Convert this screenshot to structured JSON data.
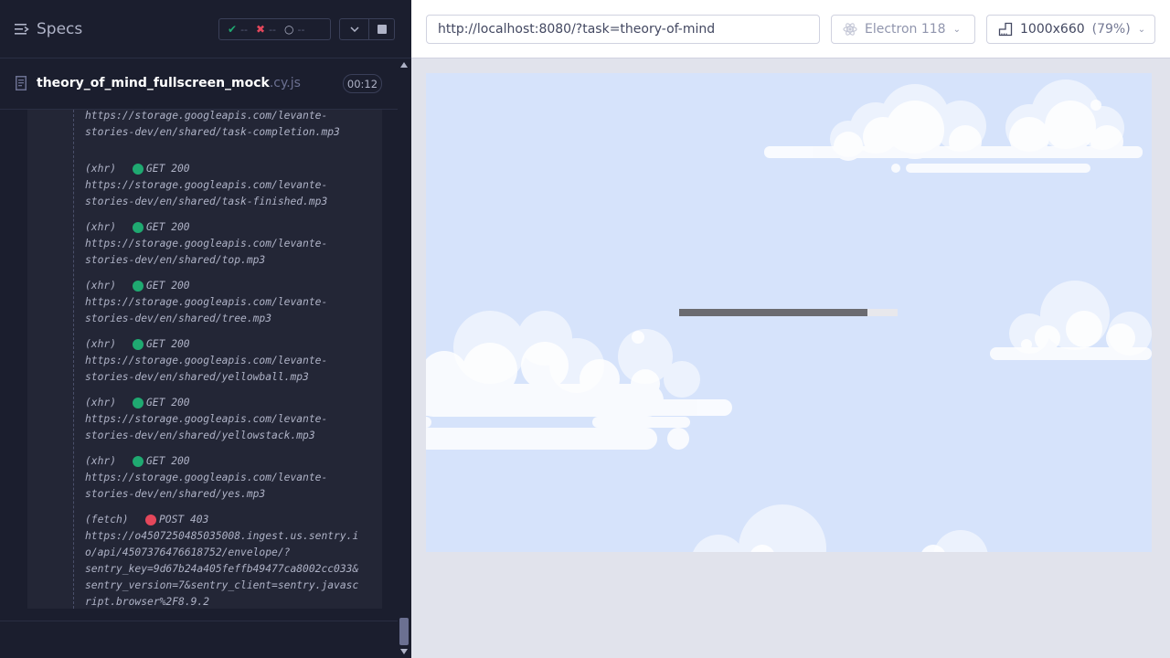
{
  "reporter": {
    "specs_label": "Specs",
    "stats": {
      "passed": "--",
      "failed": "--",
      "pending": "--"
    },
    "spec_file": {
      "name": "theory_of_mind_fullscreen_mock",
      "ext": ".cy.js"
    },
    "duration": "00:12"
  },
  "log": {
    "entries": [
      {
        "kind": "",
        "status": "",
        "method": "",
        "url": "https://storage.googleapis.com/levante-\nstories-dev/en/shared/task-completion.mp3"
      },
      {
        "kind": "(xhr)",
        "status": "ok",
        "method": "GET 200",
        "url": "https://storage.googleapis.com/levante-\nstories-dev/en/shared/task-finished.mp3"
      },
      {
        "kind": "(xhr)",
        "status": "ok",
        "method": "GET 200",
        "url": "https://storage.googleapis.com/levante-\nstories-dev/en/shared/top.mp3"
      },
      {
        "kind": "(xhr)",
        "status": "ok",
        "method": "GET 200",
        "url": "https://storage.googleapis.com/levante-\nstories-dev/en/shared/tree.mp3"
      },
      {
        "kind": "(xhr)",
        "status": "ok",
        "method": "GET 200",
        "url": "https://storage.googleapis.com/levante-\nstories-dev/en/shared/yellowball.mp3"
      },
      {
        "kind": "(xhr)",
        "status": "ok",
        "method": "GET 200",
        "url": "https://storage.googleapis.com/levante-\nstories-dev/en/shared/yellowstack.mp3"
      },
      {
        "kind": "(xhr)",
        "status": "ok",
        "method": "GET 200",
        "url": "https://storage.googleapis.com/levante-\nstories-dev/en/shared/yes.mp3"
      },
      {
        "kind": "(fetch)",
        "status": "err",
        "method": "POST 403",
        "url": "https://o4507250485035008.ingest.us.sentry.i\no/api/4507376476618752/envelope/?\nsentry_key=9d67b24a405feffb49477ca8002cc033&\nsentry_version=7&sentry_client=sentry.javasc\nript.browser%2F8.9.2"
      }
    ]
  },
  "browser_bar": {
    "url": "http://localhost:8080/?task=theory-of-mind",
    "browser": "Electron 118",
    "viewport": "1000x660",
    "scale": "(79%)"
  },
  "app": {
    "loading_progress": 0.86
  },
  "colors": {
    "pass": "#1fa971",
    "fail": "#e4475b",
    "sky": "#d6e3fb",
    "progress_fill": "#6b6b70"
  }
}
